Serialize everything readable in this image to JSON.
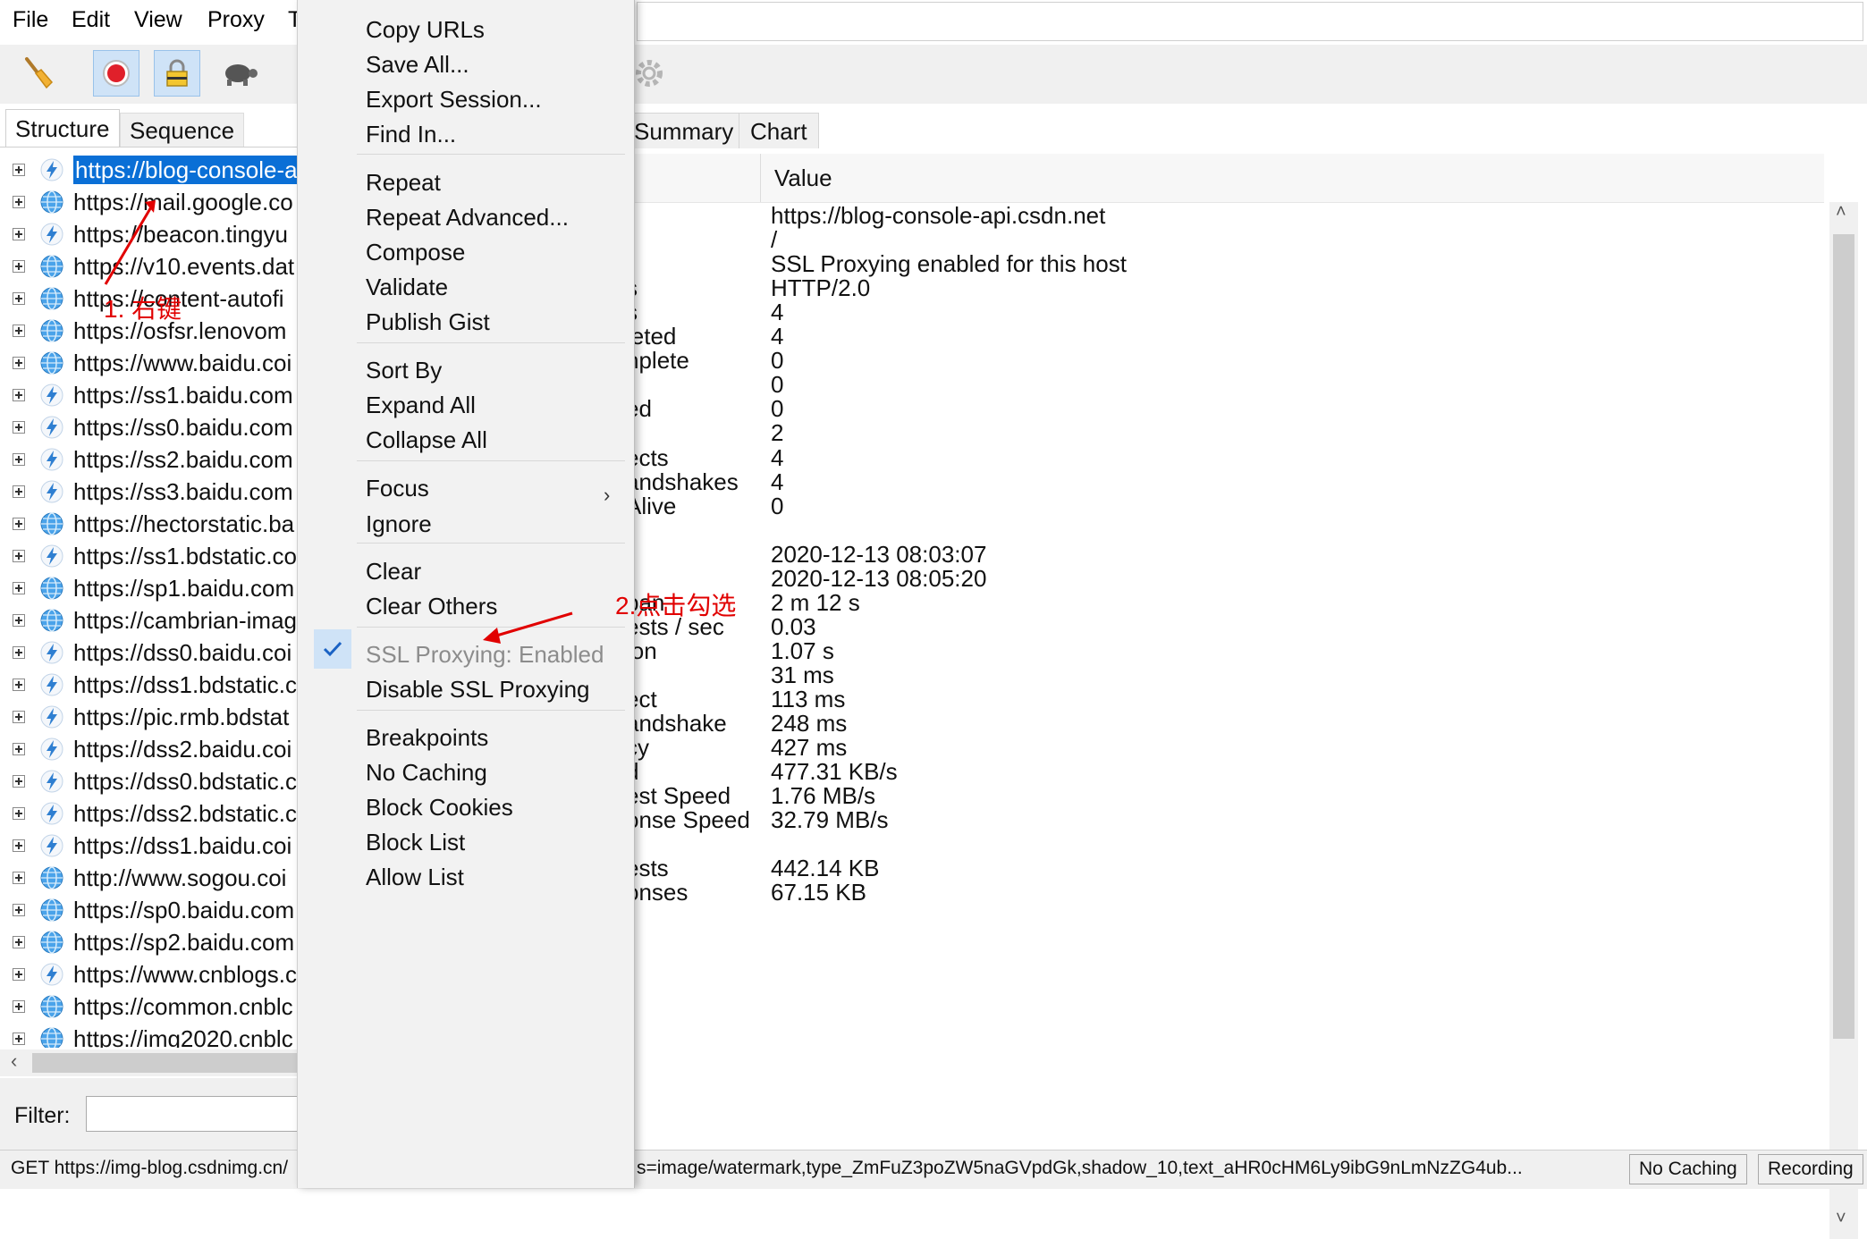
{
  "menubar": {
    "items": [
      "File",
      "Edit",
      "View",
      "Proxy",
      "T"
    ]
  },
  "left_panel": {
    "tabs": [
      "Structure",
      "Sequence"
    ],
    "tree_rows": [
      {
        "text": "https://blog-console-a",
        "icon": "bolt-icon",
        "selected": true
      },
      {
        "text": "https://mail.google.co",
        "icon": "globe-icon"
      },
      {
        "text": "https://beacon.tingyu",
        "icon": "bolt-icon"
      },
      {
        "text": "https://v10.events.dat",
        "icon": "globe-icon"
      },
      {
        "text": "https://content-autofi",
        "icon": "globe-icon"
      },
      {
        "text": "https://osfsr.lenovom",
        "icon": "globe-icon"
      },
      {
        "text": "https://www.baidu.coi",
        "icon": "globe-icon"
      },
      {
        "text": "https://ss1.baidu.com",
        "icon": "bolt-icon"
      },
      {
        "text": "https://ss0.baidu.com",
        "icon": "bolt-icon"
      },
      {
        "text": "https://ss2.baidu.com",
        "icon": "bolt-icon"
      },
      {
        "text": "https://ss3.baidu.com",
        "icon": "bolt-icon"
      },
      {
        "text": "https://hectorstatic.ba",
        "icon": "globe-icon"
      },
      {
        "text": "https://ss1.bdstatic.co",
        "icon": "bolt-icon"
      },
      {
        "text": "https://sp1.baidu.com",
        "icon": "globe-icon"
      },
      {
        "text": "https://cambrian-imag",
        "icon": "globe-icon"
      },
      {
        "text": "https://dss0.baidu.coi",
        "icon": "bolt-icon"
      },
      {
        "text": "https://dss1.bdstatic.c",
        "icon": "bolt-icon"
      },
      {
        "text": "https://pic.rmb.bdstat",
        "icon": "bolt-icon"
      },
      {
        "text": "https://dss2.baidu.coi",
        "icon": "bolt-icon"
      },
      {
        "text": "https://dss0.bdstatic.c",
        "icon": "bolt-icon"
      },
      {
        "text": "https://dss2.bdstatic.c",
        "icon": "bolt-icon"
      },
      {
        "text": "https://dss1.baidu.coi",
        "icon": "bolt-icon"
      },
      {
        "text": "http://www.sogou.coi",
        "icon": "globe-icon"
      },
      {
        "text": "https://sp0.baidu.com",
        "icon": "globe-icon"
      },
      {
        "text": "https://sp2.baidu.com",
        "icon": "globe-icon"
      },
      {
        "text": "https://www.cnblogs.c",
        "icon": "bolt-icon"
      },
      {
        "text": "https://common.cnblc",
        "icon": "globe-icon"
      },
      {
        "text": "https://img2020.cnblc",
        "icon": "globe-icon"
      }
    ],
    "filter_label": "Filter:"
  },
  "context_menu": {
    "items": [
      {
        "label": "Copy URLs"
      },
      {
        "label": "Save All..."
      },
      {
        "label": "Export Session..."
      },
      {
        "label": "Find In..."
      },
      {
        "label": "Repeat"
      },
      {
        "label": "Repeat Advanced..."
      },
      {
        "label": "Compose"
      },
      {
        "label": "Validate"
      },
      {
        "label": "Publish Gist"
      },
      {
        "label": "Sort By"
      },
      {
        "label": "Expand All"
      },
      {
        "label": "Collapse All"
      },
      {
        "label": "Focus"
      },
      {
        "label": "Ignore"
      },
      {
        "label": "Clear"
      },
      {
        "label": "Clear Others"
      },
      {
        "label": "SSL Proxying: Enabled",
        "disabled": true
      },
      {
        "label": "Disable SSL Proxying"
      },
      {
        "label": "Breakpoints"
      },
      {
        "label": "No Caching"
      },
      {
        "label": "Block Cookies"
      },
      {
        "label": "Block List"
      },
      {
        "label": "Allow List"
      }
    ]
  },
  "right_panel": {
    "tabs": [
      "Summary",
      "Chart"
    ],
    "value_header": "Value",
    "rows": [
      {
        "key": "",
        "value": "https://blog-console-api.csdn.net"
      },
      {
        "key": "",
        "value": "/"
      },
      {
        "key": "",
        "value": "SSL Proxying enabled for this host"
      },
      {
        "key": "s",
        "value": "HTTP/2.0"
      },
      {
        "key": "s",
        "value": "4"
      },
      {
        "key": "leted",
        "value": "4"
      },
      {
        "key": "nplete",
        "value": "0"
      },
      {
        "key": "",
        "value": "0"
      },
      {
        "key": "ed",
        "value": "0"
      },
      {
        "key": "",
        "value": "2"
      },
      {
        "key": "ects",
        "value": "4"
      },
      {
        "key": "andshakes",
        "value": "4"
      },
      {
        "key": "Alive",
        "value": "0"
      },
      {
        "key": "",
        "value": ""
      },
      {
        "key": "",
        "value": "2020-12-13 08:03:07"
      },
      {
        "key": "",
        "value": "2020-12-13 08:05:20"
      },
      {
        "key": "pan",
        "value": "2 m 12 s"
      },
      {
        "key": "ests / sec",
        "value": "0.03"
      },
      {
        "key": "ion",
        "value": "1.07 s"
      },
      {
        "key": "",
        "value": "31 ms"
      },
      {
        "key": "ect",
        "value": "113 ms"
      },
      {
        "key": "andshake",
        "value": "248 ms"
      },
      {
        "key": "cy",
        "value": "427 ms"
      },
      {
        "key": "d",
        "value": "477.31 KB/s"
      },
      {
        "key": "est Speed",
        "value": "1.76 MB/s"
      },
      {
        "key": "onse Speed",
        "value": "32.79 MB/s"
      },
      {
        "key": "",
        "value": ""
      },
      {
        "key": "ests",
        "value": "442.14 KB"
      },
      {
        "key": "onses",
        "value": "67.15 KB"
      }
    ]
  },
  "statusbar": {
    "left_text": "GET https://img-blog.csdnimg.cn/",
    "right_text": "s=image/watermark,type_ZmFuZ3poZW5naGVpdGk,shadow_10,text_aHR0cHM6Ly9ibG9nLmNzZG4ub...",
    "no_caching": "No Caching",
    "recording": "Recording"
  },
  "annotations": {
    "step1": "1. 右键",
    "step2": "2.点击勾选"
  },
  "colors": {
    "selection": "#0a6fd6",
    "annotation": "#e10000",
    "check_bg": "#cfe3f7"
  }
}
